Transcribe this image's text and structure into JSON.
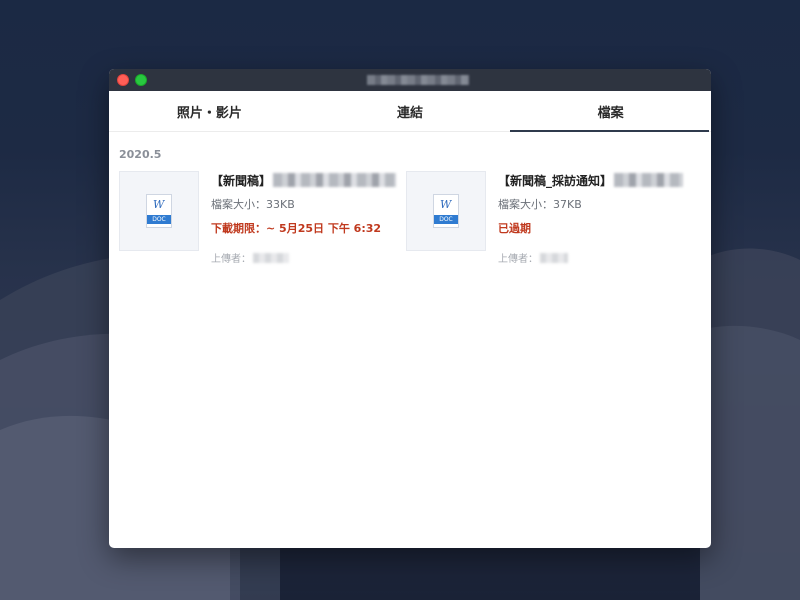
{
  "tabs": [
    {
      "label": "照片・影片"
    },
    {
      "label": "連結"
    },
    {
      "label": "檔案"
    }
  ],
  "active_tab": "檔案",
  "group_label": "2020.5",
  "files": [
    {
      "name": "【新聞稿】",
      "icon": "word-doc-icon",
      "icon_letter": "W",
      "icon_tag": "DOC",
      "size": "檔案大小：33KB",
      "status": "下載期限：~ 5月25日 下午 6:32",
      "uploader": "上傳者："
    },
    {
      "name": "【新聞稿_採訪通知】",
      "icon": "word-doc-icon",
      "icon_letter": "W",
      "icon_tag": "DOC",
      "size": "檔案大小：37KB",
      "status": "已過期",
      "uploader": "上傳者："
    }
  ],
  "colors": {
    "status_red": "#c0391e",
    "titlebar": "#2e3440",
    "tab_underline": "#2f3a4c"
  }
}
